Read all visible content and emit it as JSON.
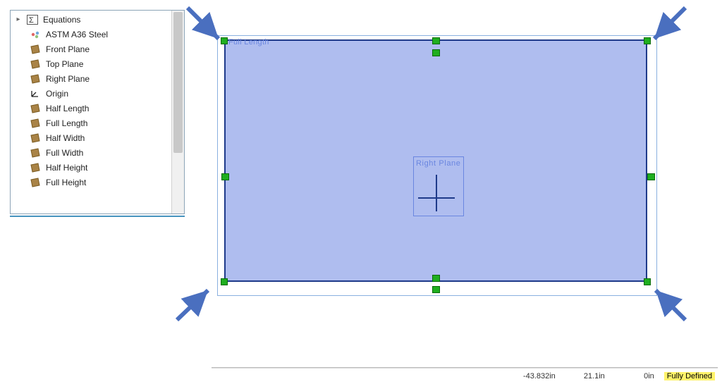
{
  "tree": {
    "equations": "Equations",
    "material": "ASTM A36 Steel",
    "front_plane": "Front Plane",
    "top_plane": "Top Plane",
    "right_plane": "Right Plane",
    "origin": "Origin",
    "half_length": "Half Length",
    "full_length": "Full Length",
    "half_width": "Half Width",
    "full_width": "Full Width",
    "half_height": "Half Height",
    "full_height": "Full Height"
  },
  "viewport": {
    "top_label": "Full Length",
    "right_plane_label": "Right Plane"
  },
  "status": {
    "x": "-43.832in",
    "y": "21.1in",
    "z": "0in",
    "state": "Fully Defined"
  }
}
